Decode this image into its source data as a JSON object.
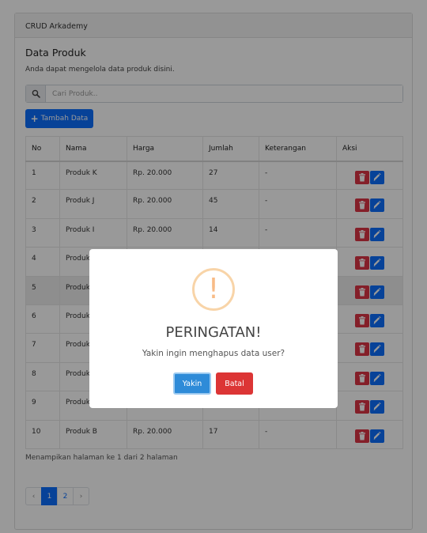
{
  "app": {
    "header_title": "CRUD Arkademy"
  },
  "page": {
    "title": "Data Produk",
    "subtitle": "Anda dapat mengelola data produk disini."
  },
  "search": {
    "placeholder": "Cari Produk..",
    "icon": "search-icon"
  },
  "toolbar": {
    "add_label": "Tambah Data",
    "add_icon": "plus-icon"
  },
  "table": {
    "columns": [
      "No",
      "Nama",
      "Harga",
      "Jumlah",
      "Keterangan",
      "Aksi"
    ],
    "rows": [
      {
        "no": "1",
        "nama": "Produk K",
        "harga": "Rp. 20.000",
        "jumlah": "27",
        "keterangan": "-"
      },
      {
        "no": "2",
        "nama": "Produk J",
        "harga": "Rp. 20.000",
        "jumlah": "45",
        "keterangan": "-"
      },
      {
        "no": "3",
        "nama": "Produk I",
        "harga": "Rp. 20.000",
        "jumlah": "14",
        "keterangan": "-"
      },
      {
        "no": "4",
        "nama": "Produk",
        "harga": "",
        "jumlah": "",
        "keterangan": ""
      },
      {
        "no": "5",
        "nama": "Produk",
        "harga": "",
        "jumlah": "",
        "keterangan": ""
      },
      {
        "no": "6",
        "nama": "Produk",
        "harga": "",
        "jumlah": "",
        "keterangan": ""
      },
      {
        "no": "7",
        "nama": "Produk",
        "harga": "",
        "jumlah": "",
        "keterangan": ""
      },
      {
        "no": "8",
        "nama": "Produk",
        "harga": "",
        "jumlah": "",
        "keterangan": ""
      },
      {
        "no": "9",
        "nama": "Produk",
        "harga": "",
        "jumlah": "",
        "keterangan": ""
      },
      {
        "no": "10",
        "nama": "Produk B",
        "harga": "Rp. 20.000",
        "jumlah": "17",
        "keterangan": "-"
      }
    ],
    "highlighted_row": 5
  },
  "footer": {
    "page_info": "Menampikan halaman ke 1 dari 2 halaman"
  },
  "pagination": {
    "prev": "‹",
    "pages": [
      "1",
      "2"
    ],
    "next": "›",
    "active": "1"
  },
  "modal": {
    "icon_glyph": "!",
    "title": "PERINGATAN!",
    "message": "Yakin ingin menghapus data user?",
    "confirm_label": "Yakin",
    "cancel_label": "Batal"
  },
  "colors": {
    "primary": "#0d6efd",
    "danger": "#dc3545",
    "warning": "#f8bb86",
    "confirm": "#2e8bd8"
  }
}
